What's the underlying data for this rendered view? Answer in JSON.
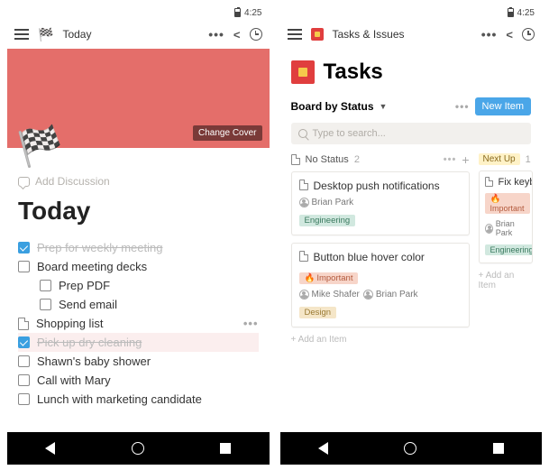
{
  "statusbar": {
    "time": "4:25"
  },
  "left": {
    "header": {
      "title": "Today"
    },
    "cover": {
      "change_label": "Change Cover",
      "icon": "🏁"
    },
    "add_discussion": "Add Discussion",
    "page_title": "Today",
    "todos": [
      {
        "text": "Prep for weekly meeting",
        "done": true,
        "type": "check"
      },
      {
        "text": "Board meeting decks",
        "done": false,
        "type": "check"
      },
      {
        "text": "Prep PDF",
        "done": false,
        "type": "check",
        "indent": true
      },
      {
        "text": "Send email",
        "done": false,
        "type": "check",
        "indent": true
      },
      {
        "text": "Shopping list",
        "type": "page",
        "has_menu": true
      },
      {
        "text": "Pick up dry cleaning",
        "done": true,
        "type": "check",
        "highlight": "pink"
      },
      {
        "text": "Shawn's baby shower",
        "done": false,
        "type": "check"
      },
      {
        "text": "Call with Mary",
        "done": false,
        "type": "check"
      },
      {
        "text": "Lunch with marketing candidate",
        "done": false,
        "type": "check"
      }
    ]
  },
  "right": {
    "header": {
      "title": "Tasks & Issues"
    },
    "page_title": "Tasks",
    "view_name": "Board by Status",
    "new_item_label": "New Item",
    "search_placeholder": "Type to search...",
    "columns": [
      {
        "name": "No Status",
        "count": 2,
        "cards": [
          {
            "title": "Desktop push notifications",
            "people": [
              "Brian Park"
            ],
            "tags": [
              {
                "label": "Engineering",
                "kind": "eng"
              }
            ]
          },
          {
            "title": "Button blue hover color",
            "prefix_tags": [
              {
                "label": "Important",
                "kind": "imp",
                "fire": true
              }
            ],
            "people": [
              "Mike Shafer",
              "Brian Park"
            ],
            "tags": [
              {
                "label": "Design",
                "kind": "des"
              }
            ]
          }
        ],
        "add_label": "Add an Item"
      },
      {
        "name": "Next Up",
        "count": 1,
        "cards": [
          {
            "title": "Fix keyboa",
            "prefix_tags": [
              {
                "label": "Important",
                "kind": "imp",
                "fire": true
              }
            ],
            "people": [
              "Brian Park"
            ],
            "tags": [
              {
                "label": "Engineering",
                "kind": "eng"
              }
            ]
          }
        ],
        "add_label": "Add an Item"
      }
    ]
  }
}
